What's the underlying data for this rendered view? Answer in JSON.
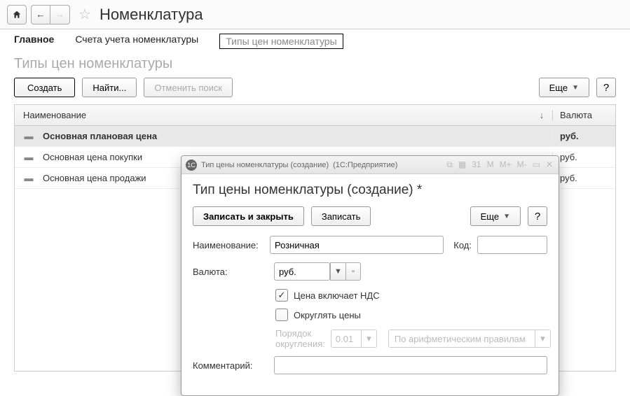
{
  "header": {
    "title": "Номенклатура"
  },
  "tabs": {
    "main": "Главное",
    "accounts": "Счета учета номенклатуры",
    "price_types": "Типы цен номенклатуры"
  },
  "section_title": "Типы цен номенклатуры",
  "toolbar": {
    "create": "Создать",
    "find": "Найти...",
    "cancel_search": "Отменить поиск",
    "more": "Еще",
    "help": "?"
  },
  "table": {
    "col_name": "Наименование",
    "sort_indicator": "↓",
    "col_currency": "Валюта",
    "rows": [
      {
        "name": "Основная плановая цена",
        "currency": "руб."
      },
      {
        "name": "Основная цена покупки",
        "currency": "руб."
      },
      {
        "name": "Основная цена продажи",
        "currency": "руб."
      }
    ]
  },
  "modal": {
    "window_title": "Тип цены номенклатуры (создание)",
    "window_subtitle": "(1С:Предприятие)",
    "heading": "Тип цены номенклатуры (создание) *",
    "save_close": "Записать и закрыть",
    "save": "Записать",
    "more": "Еще",
    "help": "?",
    "name_label": "Наименование:",
    "name_value": "Розничная",
    "code_label": "Код:",
    "code_value": "",
    "currency_label": "Валюта:",
    "currency_value": "руб.",
    "vat_label": "Цена включает НДС",
    "round_label": "Округлять цены",
    "round_order_label": "Порядок округления:",
    "round_value": "0.01",
    "round_rule": "По арифметическим правилам",
    "comment_label": "Комментарий:",
    "titlebar_icons": {
      "m_minus": "M-",
      "m_plus": "M+",
      "m": "M",
      "calendar": "31",
      "min": "▭",
      "close": "✕"
    }
  }
}
